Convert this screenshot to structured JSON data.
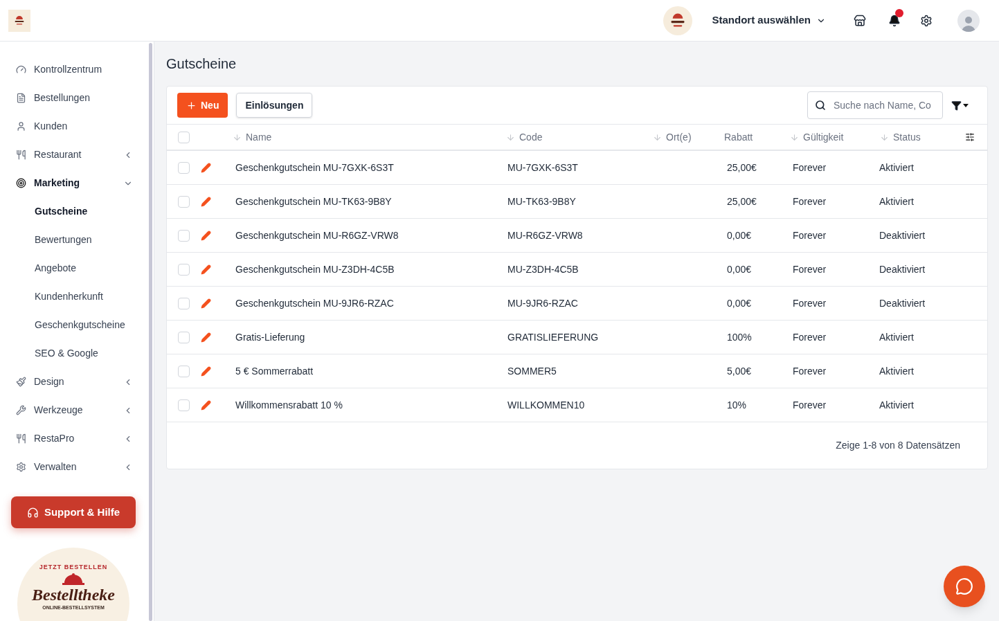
{
  "header": {
    "location_select": "Standort auswählen",
    "notifications": {
      "unread": true
    }
  },
  "sidebar": {
    "items": [
      {
        "label": "Kontrollzentrum",
        "kind": "link"
      },
      {
        "label": "Bestellungen",
        "kind": "link"
      },
      {
        "label": "Kunden",
        "kind": "link"
      },
      {
        "label": "Restaurant",
        "kind": "group",
        "expanded": false
      },
      {
        "label": "Marketing",
        "kind": "group",
        "expanded": true,
        "children": [
          {
            "label": "Gutscheine",
            "selected": true
          },
          {
            "label": "Bewertungen",
            "selected": false
          },
          {
            "label": "Angebote",
            "selected": false
          },
          {
            "label": "Kundenherkunft",
            "selected": false
          },
          {
            "label": "Geschenkgutscheine",
            "selected": false
          },
          {
            "label": "SEO & Google",
            "selected": false
          }
        ]
      },
      {
        "label": "Design",
        "kind": "group",
        "expanded": false
      },
      {
        "label": "Werkzeuge",
        "kind": "group",
        "expanded": false
      },
      {
        "label": "RestaPro",
        "kind": "group",
        "expanded": false
      },
      {
        "label": "Verwalten",
        "kind": "group",
        "expanded": false
      }
    ],
    "support_button": "Support & Hilfe",
    "logo": {
      "arc": "JETZT BESTELLEN",
      "name": "Bestelltheke",
      "tagline": "ONLINE-BESTELLSYSTEM"
    }
  },
  "page": {
    "title": "Gutscheine",
    "toolbar": {
      "new_button": "Neu",
      "redemptions_button": "Einlösungen",
      "search": {
        "placeholder": "Suche nach Name, Co"
      }
    },
    "table": {
      "all_checked": false,
      "columns": [
        {
          "label": "Name",
          "sortable": true
        },
        {
          "label": "Code",
          "sortable": true
        },
        {
          "label": "Ort(e)",
          "sortable": true
        },
        {
          "label": "Rabatt",
          "sortable": false
        },
        {
          "label": "Gültigkeit",
          "sortable": true
        },
        {
          "label": "Status",
          "sortable": true
        }
      ],
      "rows": [
        {
          "checked": false,
          "name": "Geschenkgutschein MU-7GXK-6S3T",
          "code": "MU-7GXK-6S3T",
          "discount": "25,00€",
          "validity": "Forever",
          "status": "Aktiviert"
        },
        {
          "checked": false,
          "name": "Geschenkgutschein MU-TK63-9B8Y",
          "code": "MU-TK63-9B8Y",
          "discount": "25,00€",
          "validity": "Forever",
          "status": "Aktiviert"
        },
        {
          "checked": false,
          "name": "Geschenkgutschein MU-R6GZ-VRW8",
          "code": "MU-R6GZ-VRW8",
          "discount": "0,00€",
          "validity": "Forever",
          "status": "Deaktiviert"
        },
        {
          "checked": false,
          "name": "Geschenkgutschein MU-Z3DH-4C5B",
          "code": "MU-Z3DH-4C5B",
          "discount": "0,00€",
          "validity": "Forever",
          "status": "Deaktiviert"
        },
        {
          "checked": false,
          "name": "Geschenkgutschein MU-9JR6-RZAC",
          "code": "MU-9JR6-RZAC",
          "discount": "0,00€",
          "validity": "Forever",
          "status": "Deaktiviert"
        },
        {
          "checked": false,
          "name": "Gratis-Lieferung",
          "code": "GRATISLIEFERUNG",
          "discount": "100%",
          "validity": "Forever",
          "status": "Aktiviert"
        },
        {
          "checked": false,
          "name": "5 € Sommerrabatt",
          "code": "SOMMER5",
          "discount": "5,00€",
          "validity": "Forever",
          "status": "Aktiviert"
        },
        {
          "checked": false,
          "name": "Willkommensrabatt 10 %",
          "code": "WILLKOMMEN10",
          "discount": "10%",
          "validity": "Forever",
          "status": "Aktiviert"
        }
      ],
      "footer": "Zeige 1-8 von 8 Datensätzen"
    }
  }
}
